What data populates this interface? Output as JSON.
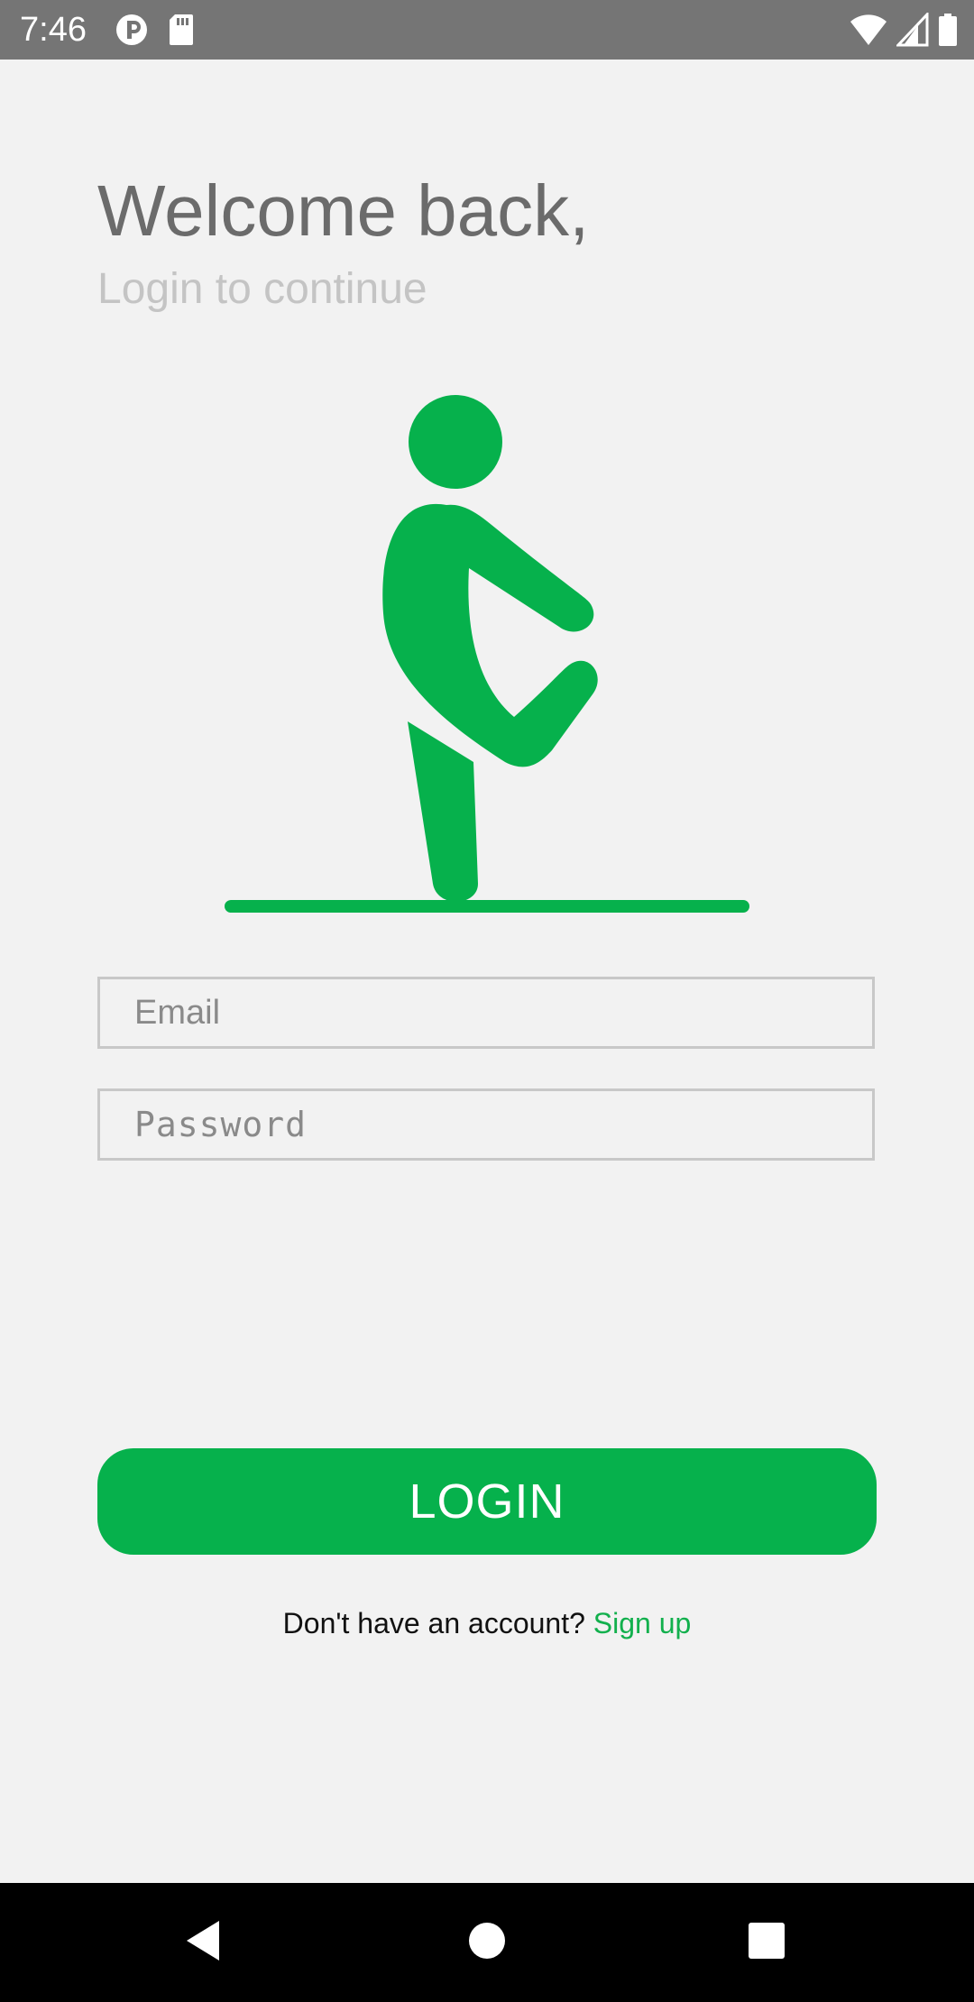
{
  "status_bar": {
    "time": "7:46",
    "left_icons": [
      "app-notification-icon",
      "sd-card-icon"
    ],
    "right_icons": [
      "wifi-icon",
      "cell-signal-icon",
      "battery-icon"
    ]
  },
  "header": {
    "title": "Welcome back,",
    "subtitle": "Login to continue"
  },
  "illustration": {
    "icon": "stretching-person-icon",
    "color": "#06b14c"
  },
  "form": {
    "email_placeholder": "Email",
    "email_value": "",
    "password_placeholder": "Password",
    "password_value": "",
    "login_label": "LOGIN"
  },
  "footer": {
    "prompt": "Don't have an account?",
    "signup_label": "Sign up"
  },
  "nav_bar": {
    "buttons": [
      "back-icon",
      "home-icon",
      "recents-icon"
    ]
  },
  "colors": {
    "accent": "#06b14c",
    "background": "#f2f2f2",
    "status_bar": "#757575",
    "title_text": "#6b6b6b",
    "subtitle_text": "#c4c4c4"
  }
}
